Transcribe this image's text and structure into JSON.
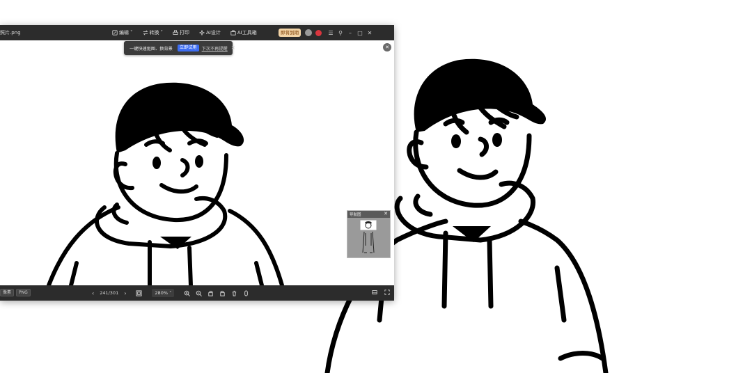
{
  "window": {
    "filename": "照片.png",
    "menu": [
      {
        "icon": "edit-icon",
        "label": "编辑",
        "dropdown": true
      },
      {
        "icon": "convert-icon",
        "label": "转换",
        "dropdown": true
      },
      {
        "icon": "print-icon",
        "label": "打印",
        "dropdown": false
      },
      {
        "icon": "ai-design-icon",
        "label": "AI设计",
        "dropdown": false
      },
      {
        "icon": "ai-toolbox-icon",
        "label": "AI工具箱",
        "dropdown": false
      }
    ],
    "vip_badge": "即将到期",
    "controls": [
      "menu-icon",
      "pin-icon",
      "minimize-icon",
      "maximize-icon",
      "close-icon"
    ]
  },
  "tip": {
    "text": "一键快速抠图、换背景",
    "try_label": "立即试用",
    "never_label": "下次不再提醒"
  },
  "navigator": {
    "title": "导航图"
  },
  "statusbar": {
    "pixels_label": "像素",
    "format": "PNG",
    "page": "241/301",
    "zoom": "280%"
  },
  "colors": {
    "titlebar_bg": "#2c2c2c",
    "tip_try_bg": "#3d6df2",
    "vip_bg": "#f3d4a6"
  }
}
